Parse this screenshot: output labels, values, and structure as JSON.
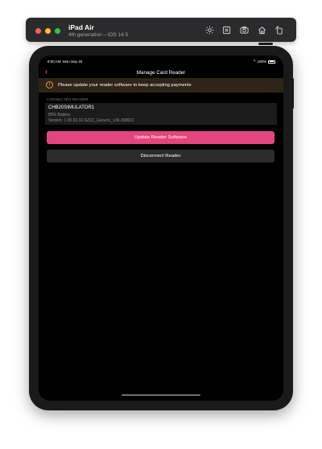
{
  "simulator": {
    "device_name": "iPad Air",
    "device_subtitle": "4th generation – iOS 14.5",
    "toolbar_icons": [
      "brightness-icon",
      "screenshot-icon",
      "camera-icon",
      "home-icon",
      "rotate-icon"
    ]
  },
  "status_bar": {
    "time": "8:00 AM",
    "date": "Mon Sep 20",
    "battery": "100%"
  },
  "nav": {
    "back_symbol": "‹",
    "title": "Manage Card Reader"
  },
  "banner": {
    "icon": "!",
    "text": "Please update your reader software to keep accepting payments",
    "colors": {
      "background": "#2e2418",
      "icon": "#e8a33a"
    }
  },
  "reader_section": {
    "header": "CONNECTED READER",
    "reader_name": "CHB20SIMULATOR1",
    "battery_text": "85% Battery",
    "version_text": "Version: 1.00.03.32-SZZZ_Generic_v36-300001"
  },
  "actions": {
    "update_label": "Update Reader Software",
    "disconnect_label": "Disconnect Reader"
  },
  "colors": {
    "accent": "#e5457d",
    "screen_background": "#000000",
    "card_background": "#1c1c1e"
  }
}
